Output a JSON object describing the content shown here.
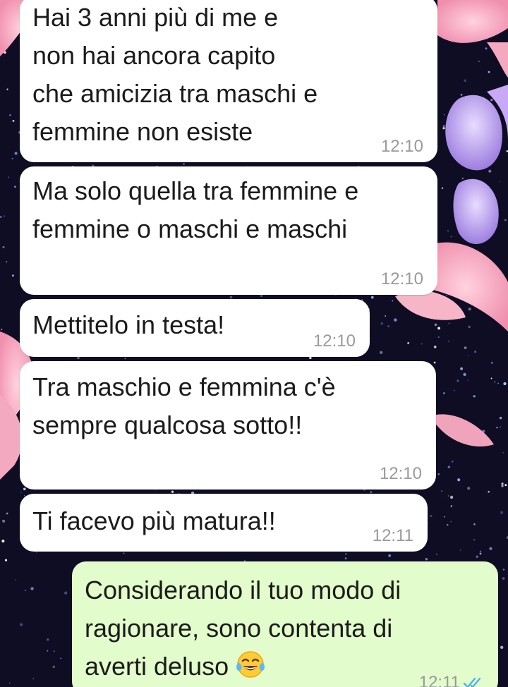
{
  "theme": {
    "incoming_bubble": "#ffffff",
    "outgoing_bubble": "#e2fccb",
    "text_color": "#1b1b1b",
    "time_color": "#9a9a9a",
    "read_tick_color": "#4fb3f0",
    "wallpaper_base": "#0f0d24"
  },
  "messages": [
    {
      "direction": "incoming",
      "text": "Hai 3 anni più di me e\nnon hai ancora capito\nche amicizia tra maschi e\nfemmine non esiste",
      "time": "12:10"
    },
    {
      "direction": "incoming",
      "text": "Ma solo quella tra femmine e\nfemmine o maschi e maschi",
      "time": "12:10"
    },
    {
      "direction": "incoming",
      "text": "Mettitelo in testa!",
      "time": "12:10"
    },
    {
      "direction": "incoming",
      "text": "Tra maschio e femmina c'è\nsempre qualcosa sotto!!",
      "time": "12:10"
    },
    {
      "direction": "incoming",
      "text": "Ti facevo più matura!!",
      "time": "12:11"
    },
    {
      "direction": "outgoing",
      "text": "Considerando il tuo modo di\nragionare, sono contenta di\naverti deluso",
      "emoji": "tears-of-joy-emoji",
      "time": "12:11",
      "status": "read"
    }
  ]
}
